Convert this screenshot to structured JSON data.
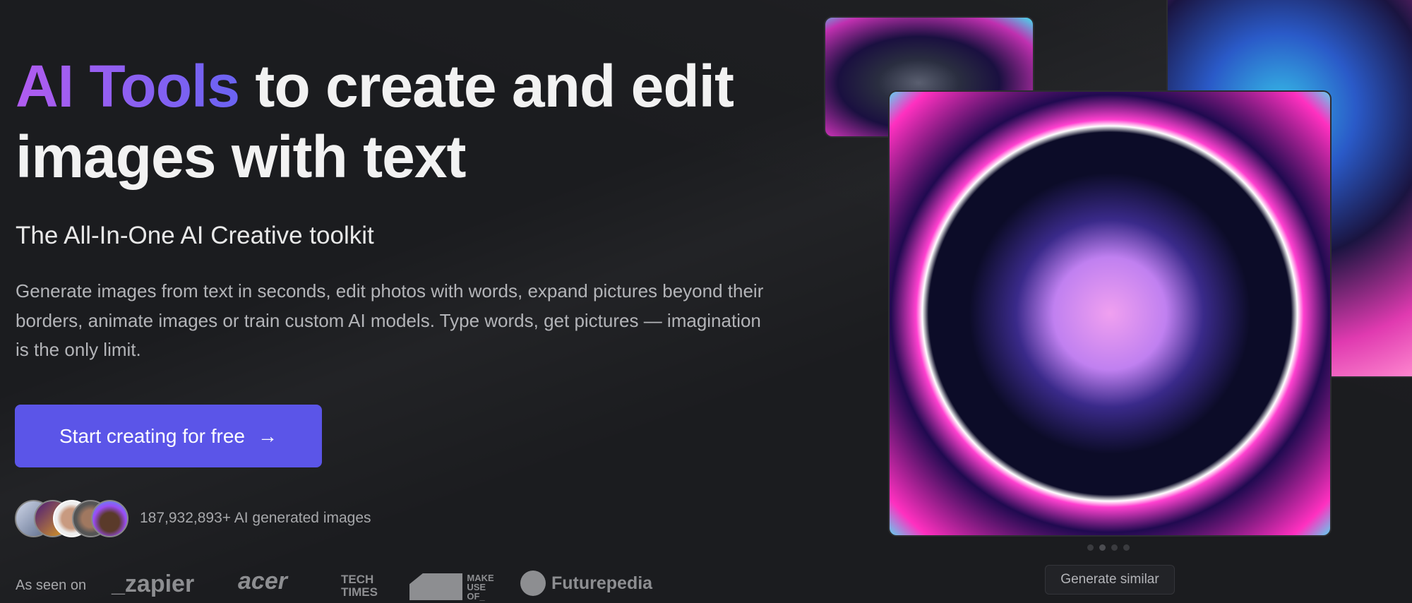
{
  "hero": {
    "title_accent": "AI Tools",
    "title_rest": " to create and edit images with text",
    "subtitle": "The All-In-One AI Creative toolkit",
    "description": "Generate images from text in seconds, edit photos with words, expand pictures beyond their borders, animate images or train custom AI models. Type words, get pictures — imagination is the only limit.",
    "cta_label": "Start creating for free",
    "cta_icon": "arrow-right-icon",
    "accent_color": "#5b55e8"
  },
  "social_proof": {
    "count_text": "187,932,893+ AI generated images"
  },
  "as_seen_on": {
    "label": "As seen on",
    "logos": [
      "_zapier",
      "acer",
      "TECH TIMES",
      "MAKE USE OF_",
      "Futurepedia"
    ]
  },
  "gallery": {
    "generate_similar_label": "Generate similar",
    "active_dot": 1,
    "dot_count": 4
  }
}
